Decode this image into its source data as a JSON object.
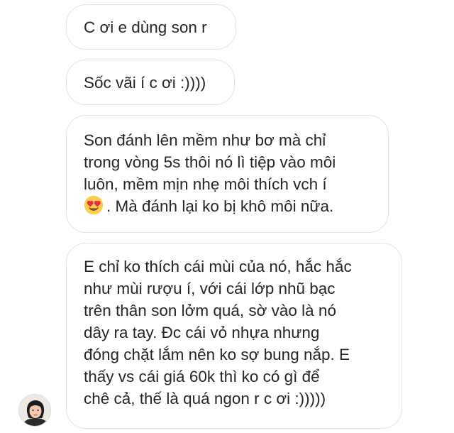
{
  "conversation": {
    "messages": [
      {
        "lines": [
          "C ơi e dùng son r"
        ]
      },
      {
        "lines": [
          "Sốc vãi í c ơi :))))"
        ]
      },
      {
        "lines": [
          "Son đánh lên mềm như bơ mà chỉ",
          "trong vòng 5s thôi nó lì tiệp vào môi",
          "luôn, mềm mịn nhẹ môi thích vch í"
        ],
        "emoji": "heart-eyes-emoji",
        "last_line": ". Mà đánh lại ko bị khô môi nữa."
      },
      {
        "lines": [
          "E chỉ ko thích cái mùi của nó, hắc hắc",
          "như mùi rượu í, với cái lớp nhũ bạc",
          "trên thân son lởm quá, sờ vào là nó",
          "dây ra tay. Đc cái vỏ nhựa nhưng",
          "đóng chặt lắm nên ko sợ bung nắp. E",
          "thấy vs cái giá 60k thì ko có gì để",
          "chê cả, thế là quá ngon r c ơi :)))))"
        ]
      }
    ]
  },
  "sender": {
    "avatar_icon": "user-avatar"
  },
  "colors": {
    "bubble_border": "#e4e4e4",
    "text": "#262626",
    "background": "#ffffff",
    "emoji_face": "#FFCC4D",
    "emoji_heart": "#E2304A"
  }
}
